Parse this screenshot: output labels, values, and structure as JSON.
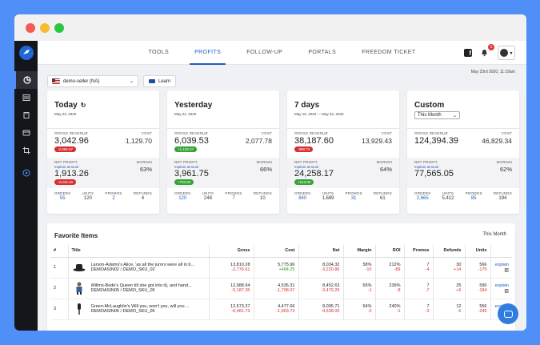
{
  "nav": {
    "tabs": [
      "TOOLS",
      "PROFITS",
      "FOLLOW-UP",
      "PORTALS",
      "FREEDOM TICKET"
    ],
    "active_tab": "PROFITS",
    "notification_count": "1"
  },
  "date_label": "May 23rd 2020, 11:19am",
  "seller": {
    "name": "demo-seller (NA)"
  },
  "learn_label": "Learn",
  "labels": {
    "gross_revenue": "GROSS REVENUE",
    "cost": "COST",
    "net_profit": "NET PROFIT",
    "explain_amount": "explain amount",
    "margin": "MARGIN",
    "orders": "ORDERS",
    "units": "UNITS",
    "promos": "PROMOS",
    "refunds": "REFUNDS"
  },
  "cards": [
    {
      "title": "Today",
      "subtitle": "May 23, 2020",
      "gross": "3,042.96",
      "gross_change": "-2,966.67",
      "cost": "1,129.70",
      "net": "1,913.26",
      "net_change": "-2,045.49",
      "margin": "63%",
      "orders": "55",
      "units": "120",
      "promos": "2",
      "refunds": "4"
    },
    {
      "title": "Yesterday",
      "subtitle": "May 22, 2020",
      "gross": "6,039.53",
      "gross_change": "+1,102.27",
      "cost": "2,077.78",
      "net": "3,961.75",
      "net_change": "+703.82",
      "margin": "66%",
      "orders": "120",
      "units": "248",
      "promos": "7",
      "refunds": "10"
    },
    {
      "title": "7 days",
      "subtitle": "May 16, 2020 — May 22, 2020",
      "gross": "38,187.60",
      "gross_change": "-988.73",
      "cost": "13,929.43",
      "net": "24,258.17",
      "net_change": "+513.00",
      "margin": "64%",
      "orders": "840",
      "units": "1,689",
      "promos": "31",
      "refunds": "61"
    },
    {
      "title": "Custom",
      "select_value": "This Month",
      "gross": "124,394.39",
      "cost": "46,829.34",
      "net": "77,565.05",
      "margin": "62%",
      "orders": "2,665",
      "units": "5,412",
      "promos": "85",
      "refunds": "194"
    }
  ],
  "favorites": {
    "title": "Favorite Items",
    "period": "This Month",
    "columns": [
      "#",
      "Title",
      "Gross",
      "Cost",
      "Net",
      "Margin",
      "ROI",
      "Promos",
      "Refunds",
      "Units"
    ],
    "rows": [
      {
        "num": "1",
        "thumb_icon": "hat-icon",
        "title": "Larson-Adams's Alice, 'as all the jurors were all in b...",
        "sku": "DEMOASIN02 / DEMO_SKU_02",
        "gross": "13,810.28",
        "gross_delta": "-2,776.61",
        "cost": "5,775.96",
        "cost_delta": "+484.25",
        "net": "8,034.32",
        "net_delta": "-3,220.86",
        "margin": "58%",
        "margin_delta": "-10",
        "roi": "212%",
        "roi_delta": "-89",
        "promos": "7",
        "promos_delta": "-4",
        "refunds": "30",
        "refunds_delta": "+14",
        "units": "566",
        "units_delta": "-175",
        "explain": "explain"
      },
      {
        "num": "2",
        "thumb_icon": "figure-icon",
        "title": "Willms-Bode's Queen till she got into it), and hand...",
        "sku": "DEMOASIN05 / DEMO_SKU_05",
        "gross": "12,988.94",
        "gross_delta": "-5,187.35",
        "cost": "4,536.31",
        "cost_delta": "-1,708.07",
        "net": "8,452.63",
        "net_delta": "-3,479.29",
        "margin": "65%",
        "margin_delta": "-1",
        "roi": "239%",
        "roi_delta": "-8",
        "promos": "7",
        "promos_delta": "-7",
        "refunds": "25",
        "refunds_delta": "+6",
        "units": "590",
        "units_delta": "-184",
        "explain": "explain"
      },
      {
        "num": "3",
        "thumb_icon": "mic-icon",
        "title": "Green-McLaughlin's Will you, won't you, will you ...",
        "sku": "DEMOASIN06 / DEMO_SKU_06",
        "gross": "12,573.37",
        "gross_delta": "-6,481.73",
        "cost": "4,477.66",
        "cost_delta": "-1,963.73",
        "net": "8,095.71",
        "net_delta": "-4,538.00",
        "margin": "64%",
        "margin_delta": "-2",
        "roi": "240%",
        "roi_delta": "-1",
        "promos": "7",
        "promos_delta": "-3",
        "refunds": "12",
        "refunds_delta": "-6",
        "units": "556",
        "units_delta": "-249",
        "explain": "explain"
      }
    ]
  }
}
